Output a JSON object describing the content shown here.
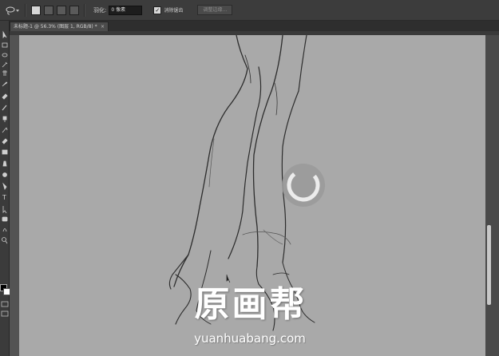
{
  "options_bar": {
    "feather_label": "羽化:",
    "feather_value": "0 像素",
    "antialias_label": "消除锯齿",
    "antialias_checked": "✓",
    "refine_edge_label": "调整边缘..."
  },
  "document_tab": {
    "title": "未标题-1 @ 56.3% (图层 1, RGB/8) *",
    "close": "×"
  },
  "watermark": {
    "brand": "原画帮",
    "url": "yuanhuabang.com"
  },
  "colors": {
    "canvas": "#a9a9a9",
    "ui_dark": "#3c3c3c",
    "foreground_swatch": "#000000",
    "background_swatch": "#ffffff"
  },
  "icons": {
    "tool_preset": "lasso-icon",
    "loading": "spinner-icon"
  }
}
